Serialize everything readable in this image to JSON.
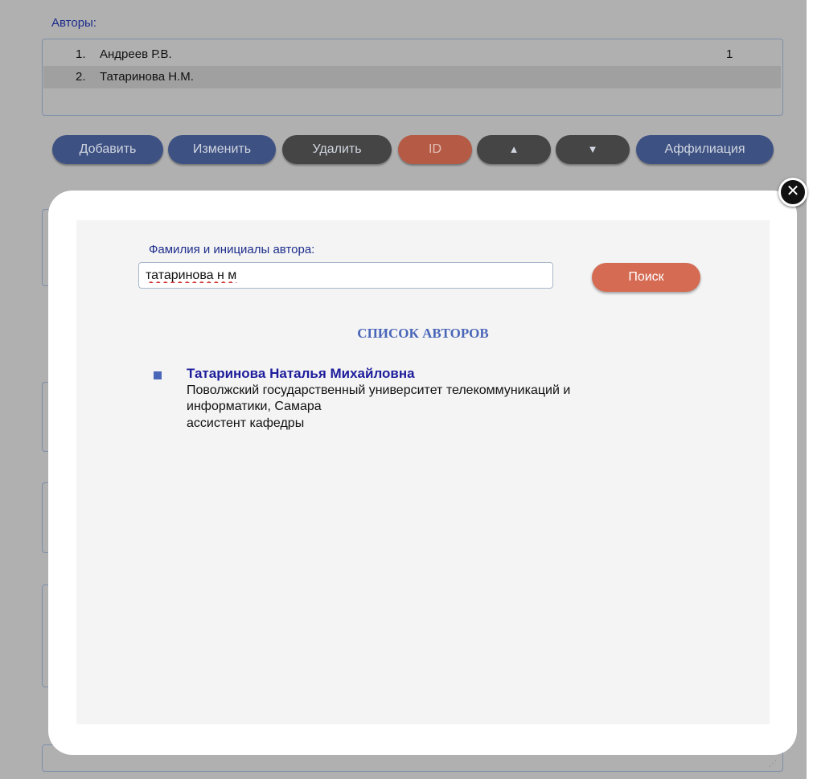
{
  "authors_section": {
    "title": "Авторы:",
    "rows": [
      {
        "num": "1.",
        "name": "Андреев Р.В.",
        "count": "1"
      },
      {
        "num": "2.",
        "name": "Татаринова Н.М.",
        "count": ""
      }
    ]
  },
  "toolbar": {
    "add_label": "Добавить",
    "edit_label": "Изменить",
    "delete_label": "Удалить",
    "id_label": "ID",
    "up_label": "▲",
    "down_label": "▼",
    "affiliation_label": "Аффилиация"
  },
  "modal": {
    "close_icon": "close-icon",
    "field_label": "Фамилия и инициалы автора:",
    "search_value": "татаринова н м",
    "search_button": "Поиск",
    "list_title": "СПИСОК АВТОРОВ",
    "results": [
      {
        "name": "Татаринова Наталья Михайловна",
        "org_line1": "Поволжский государственный университет телекоммуникаций и",
        "org_line2": "информатики, Самара",
        "position": "ассистент кафедры"
      }
    ]
  },
  "colors": {
    "overlay": "#b0b0b0",
    "label_blue": "#1d2d8c",
    "button_blue": "#3e5183",
    "button_dark": "#454545",
    "button_red": "#b55a45",
    "search_button": "#d46b52",
    "list_title": "#4a66b8"
  }
}
